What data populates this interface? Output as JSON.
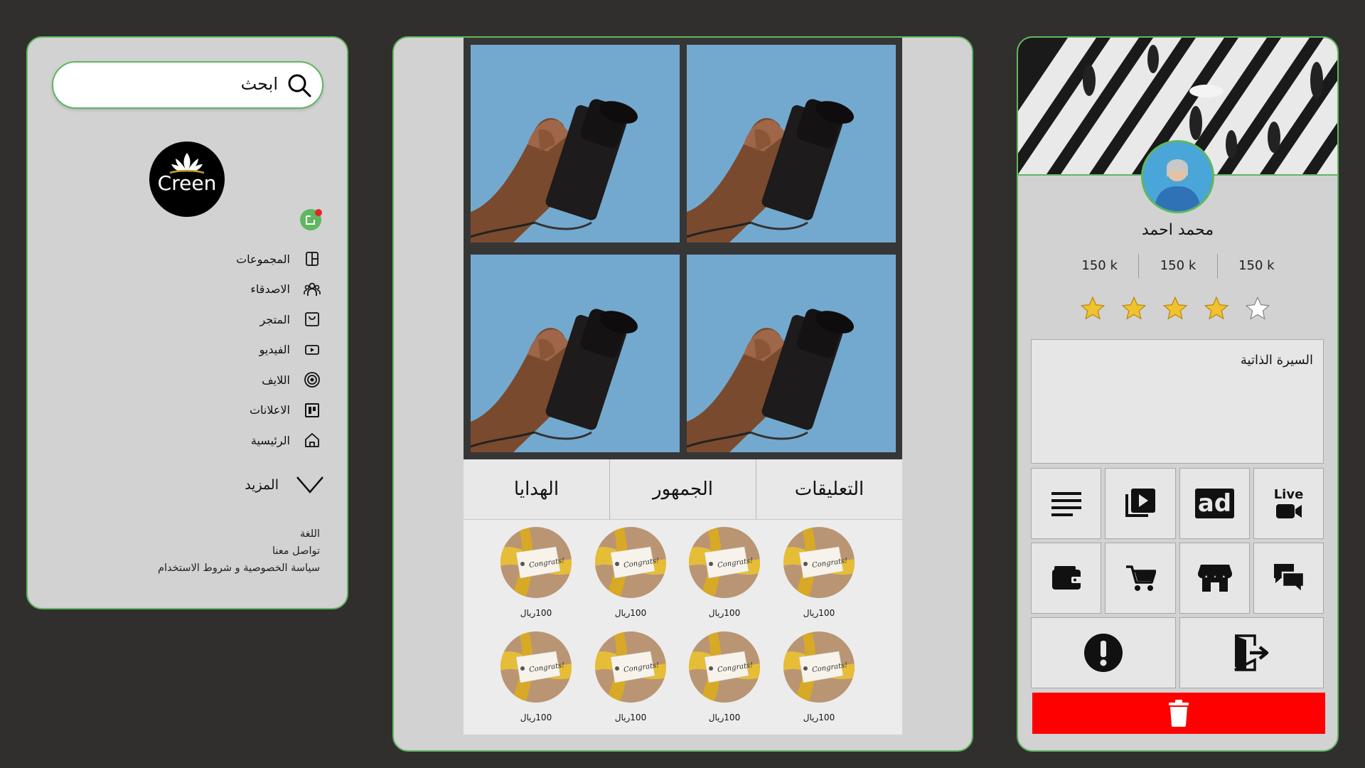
{
  "colors": {
    "accent": "#5fb760",
    "background": "#312e2e",
    "panel": "#d2d2d2",
    "danger": "#ff0000",
    "star": "#f2c12e",
    "notification": "#e5262c"
  },
  "sidebar": {
    "search": {
      "placeholder": "ابحث",
      "icon": "search-icon"
    },
    "logo_text": "Creen",
    "nav": [
      {
        "label": "المجموعات",
        "icon": "groups-icon"
      },
      {
        "label": "الاصدقاء",
        "icon": "friends-icon"
      },
      {
        "label": "المتجر",
        "icon": "store-icon"
      },
      {
        "label": "الفيديو",
        "icon": "video-icon"
      },
      {
        "label": "اللايف",
        "icon": "live-icon"
      },
      {
        "label": "الاعلانات",
        "icon": "ads-icon"
      },
      {
        "label": "الرئيسية",
        "icon": "home-icon"
      }
    ],
    "more_label": "المزيد",
    "footer": {
      "language": "اللغة",
      "contact": "تواصل معنا",
      "privacy": "سياسة الخصوصية و شروط الاستخدام"
    }
  },
  "center": {
    "tabs": [
      "الهدايا",
      "الجمهور",
      "التعليقات"
    ],
    "gifts": [
      {
        "price": "100ريال"
      },
      {
        "price": "100ريال"
      },
      {
        "price": "100ريال"
      },
      {
        "price": "100ريال"
      },
      {
        "price": "100ريال"
      },
      {
        "price": "100ريال"
      },
      {
        "price": "100ريال"
      },
      {
        "price": "100ريال"
      }
    ],
    "gift_tag": "Congrats!"
  },
  "profile": {
    "name": "محمد احمد",
    "stats": [
      "150 k",
      "150 k",
      "150 k"
    ],
    "rating": 4,
    "rating_max": 5,
    "bio_label": "السيرة الذاتية",
    "live_label": "Live",
    "ad_label": "ad"
  }
}
